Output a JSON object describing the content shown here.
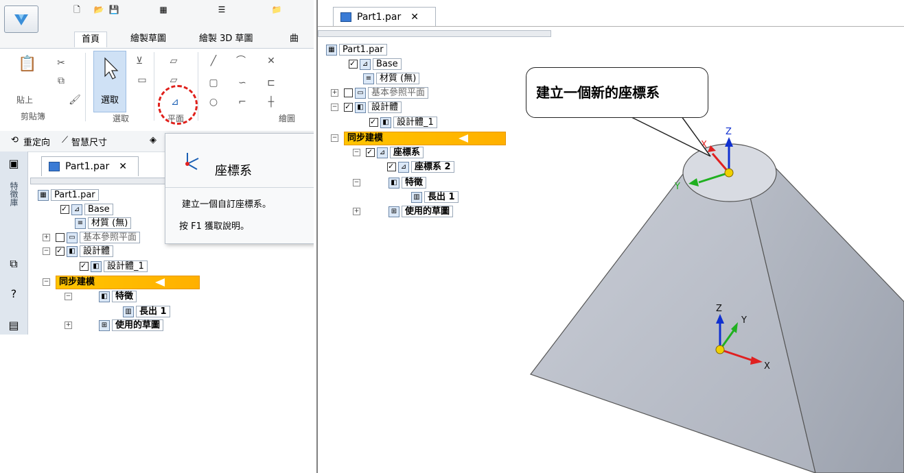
{
  "ribbon": {
    "tabs": [
      "首頁",
      "繪製草圖",
      "繪製 3D 草圖",
      "曲面"
    ],
    "active_tab": "首頁",
    "paste_label": "貼上",
    "clipboard_group": "剪貼簿",
    "select_label": "選取",
    "select_group": "選取",
    "plane_group": "平面",
    "draw_group": "繪圖"
  },
  "command_bar": {
    "reorient": "重定向",
    "smart_dim": "智慧尺寸"
  },
  "sidebar": {
    "vertical_label": "特徵庫"
  },
  "tooltip": {
    "title": "座標系",
    "description": "建立一個自訂座標系。",
    "help": "按 F1 獲取說明。"
  },
  "doc_tab": {
    "name": "Part1.par",
    "close": "✕"
  },
  "left_tree": {
    "root": "Part1.par",
    "base": "Base",
    "material": "材質 (無)",
    "ref_planes": "基本參照平面",
    "design_body": "設計體",
    "design_body_1": "設計體_1",
    "sync": "同步建模",
    "features": "特徵",
    "extrude": "長出 1",
    "used_sketches": "使用的草圖"
  },
  "right_tree": {
    "root": "Part1.par",
    "base": "Base",
    "material": "材質 (無)",
    "ref_planes": "基本參照平面",
    "design_body": "設計體",
    "design_body_1": "設計體_1",
    "sync": "同步建模",
    "csys_group": "座標系",
    "csys_2": "座標系 2",
    "features": "特徵",
    "extrude": "長出 1",
    "used_sketches": "使用的草圖"
  },
  "callout": "建立一個新的座標系",
  "axes": {
    "x": "X",
    "y": "Y",
    "z": "Z"
  },
  "colors": {
    "sync_highlight": "#ffb800",
    "annotation_red": "#e0201b",
    "axis_x": "#e02020",
    "axis_y": "#20b020",
    "axis_z": "#1030d0",
    "model_face": "#c8ccd4"
  }
}
